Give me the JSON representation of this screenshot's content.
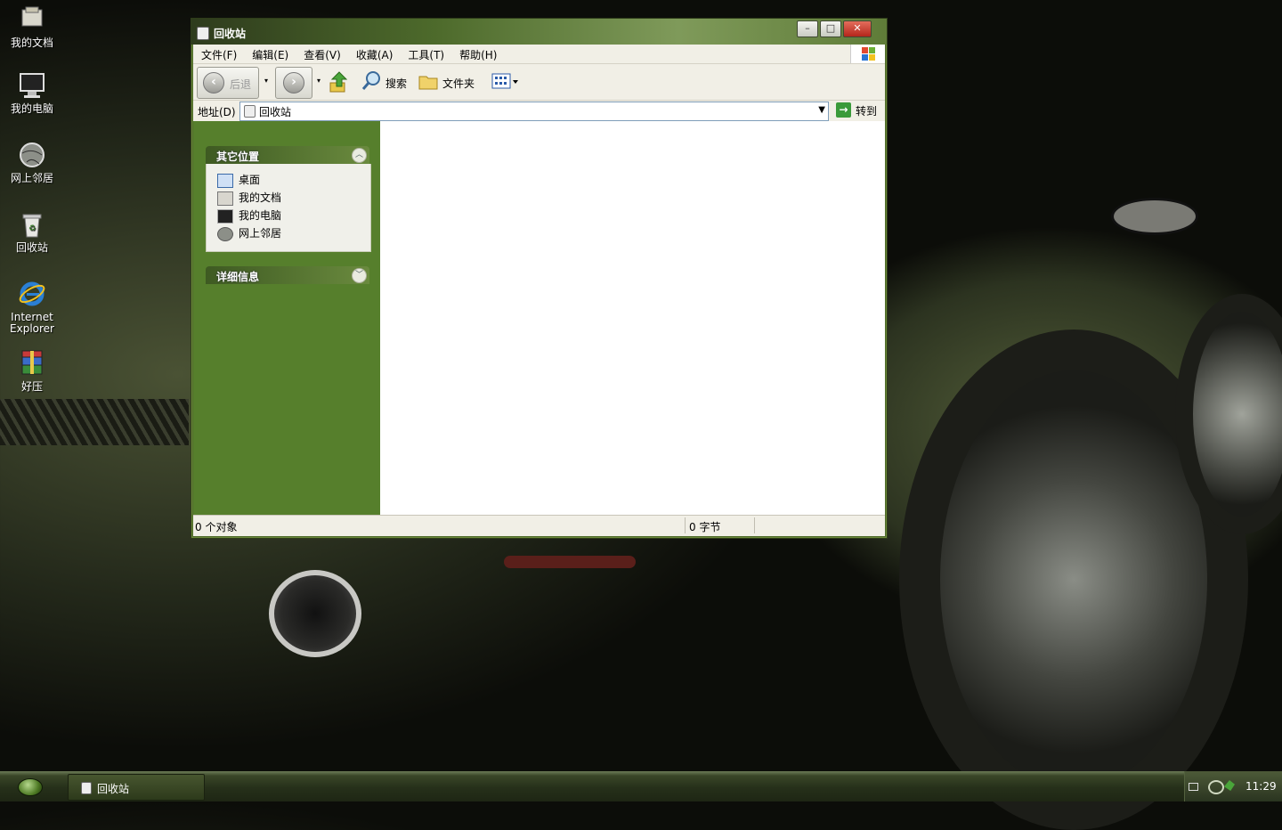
{
  "desktop": {
    "icons": [
      {
        "label": "我的文档",
        "icon": "my-documents-icon"
      },
      {
        "label": "我的电脑",
        "icon": "my-computer-icon"
      },
      {
        "label": "网上邻居",
        "icon": "network-places-icon"
      },
      {
        "label": "回收站",
        "icon": "recycle-bin-icon"
      },
      {
        "label_line1": "Internet",
        "label_line2": "Explorer",
        "icon": "internet-explorer-icon"
      },
      {
        "label": "好压",
        "icon": "haozip-icon"
      }
    ]
  },
  "window": {
    "title": "回收站",
    "menu": [
      "文件(F)",
      "编辑(E)",
      "查看(V)",
      "收藏(A)",
      "工具(T)",
      "帮助(H)"
    ],
    "toolbar": {
      "back": "后退",
      "search": "搜索",
      "folders": "文件夹"
    },
    "address": {
      "label": "地址(D)",
      "value": "回收站",
      "go": "转到"
    },
    "tasks": {
      "other_places": {
        "title": "其它位置",
        "items": [
          "桌面",
          "我的文档",
          "我的电脑",
          "网上邻居"
        ]
      },
      "details": {
        "title": "详细信息"
      }
    },
    "status": {
      "objects": "0 个对象",
      "size": "0 字节"
    }
  },
  "taskbar": {
    "items": [
      "回收站"
    ],
    "clock": "11:29"
  },
  "colors": {
    "task_pane": "#567f2c",
    "titlebar": "#4d6a2b",
    "taskbar": "#26301a"
  }
}
